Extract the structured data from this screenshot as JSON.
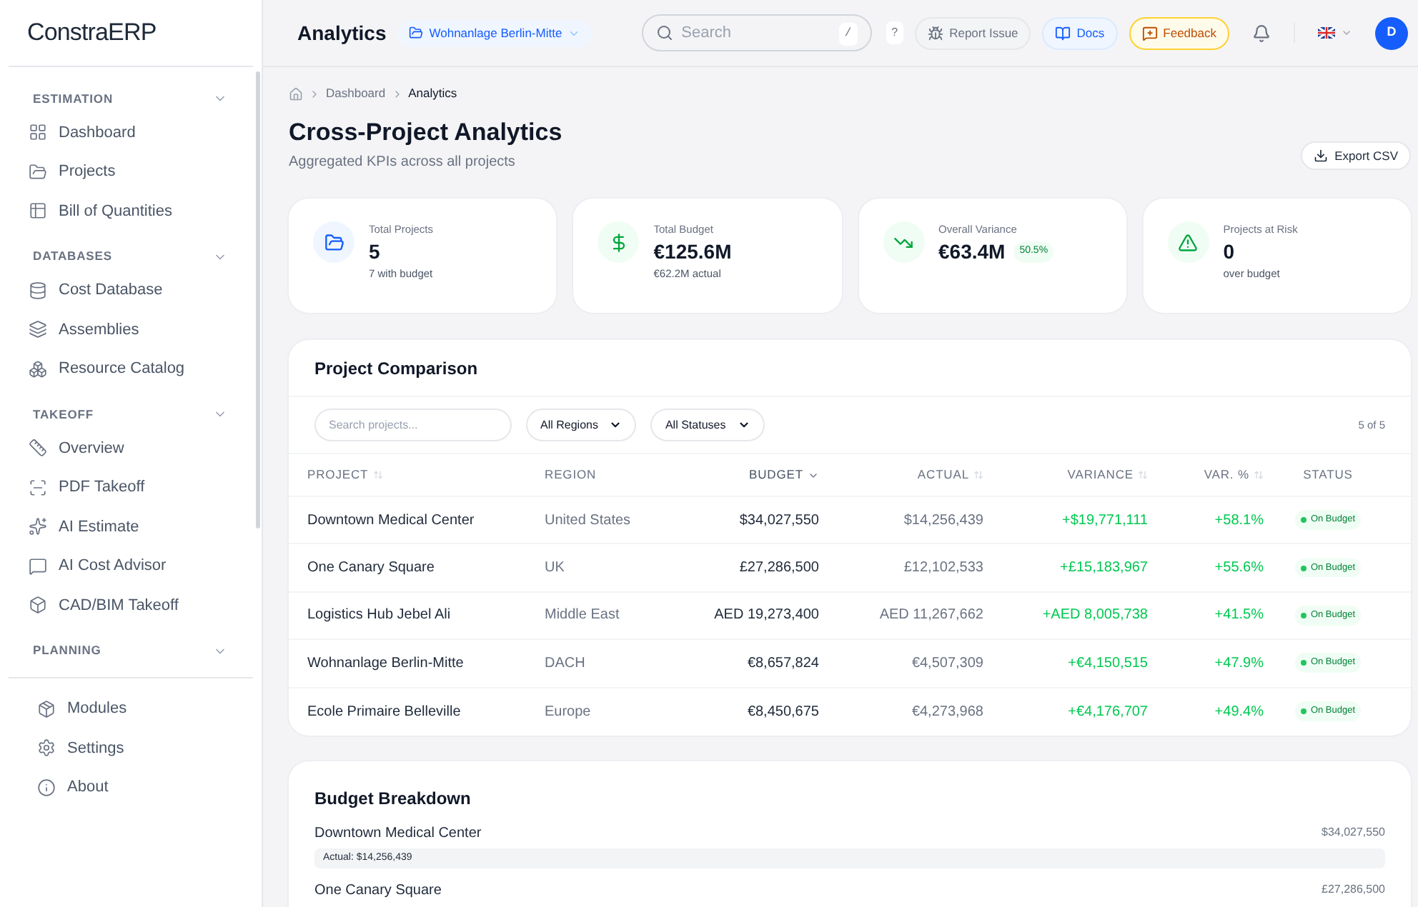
{
  "sidebar": {
    "logo": "ConstraERP",
    "sections": [
      {
        "label": "ESTIMATION",
        "expanded": true,
        "items": [
          "Dashboard",
          "Projects",
          "Bill of Quantities"
        ]
      },
      {
        "label": "DATABASES",
        "expanded": true,
        "items": [
          "Cost Database",
          "Assemblies",
          "Resource Catalog"
        ]
      },
      {
        "label": "TAKEOFF",
        "expanded": true,
        "items": [
          "Overview",
          "PDF Takeoff",
          "AI Estimate",
          "AI Cost Advisor",
          "CAD/BIM Takeoff"
        ]
      },
      {
        "label": "PLANNING",
        "expanded": true
      }
    ],
    "bottom_items": [
      "Modules",
      "Settings",
      "About"
    ]
  },
  "topbar": {
    "title": "Analytics",
    "project": "Wohnanlage Berlin-Mitte",
    "search": {
      "placeholder": "Search",
      "shortcut": "/"
    },
    "help": "?",
    "buttons": [
      {
        "label": "Report Issue",
        "kind": "report"
      },
      {
        "label": "Docs",
        "kind": "docs"
      },
      {
        "label": "Feedback",
        "kind": "feedback"
      }
    ],
    "avatar": "D"
  },
  "breadcrumb": [
    "Dashboard",
    "Analytics"
  ],
  "page": {
    "title": "Cross-Project Analytics",
    "subtitle": "Aggregated KPIs across all projects",
    "export": "Export CSV"
  },
  "kpis": [
    {
      "kind": "projects",
      "label": "Total Projects",
      "value": "5",
      "sub": "7 with budget"
    },
    {
      "kind": "budget",
      "label": "Total Budget",
      "value": "€125.6M",
      "sub": "€62.2M actual"
    },
    {
      "kind": "variance",
      "label": "Overall Variance",
      "value": "€63.4M",
      "badge": "50.5%"
    },
    {
      "kind": "risk",
      "label": "Projects at Risk",
      "value": "0",
      "sub": "over budget"
    }
  ],
  "comparison": {
    "title": "Project Comparison",
    "search": {
      "placeholder": "Search projects..."
    },
    "filters": [
      "All Regions",
      "All Statuses"
    ],
    "count": "5 of 5",
    "columns": [
      {
        "label": "PROJECT",
        "sorted": false
      },
      {
        "label": "REGION"
      },
      {
        "label": "BUDGET",
        "sorted": true
      },
      {
        "label": "ACTUAL",
        "sorted": false
      },
      {
        "label": "VARIANCE",
        "sorted": false
      },
      {
        "label": "VAR. %",
        "sorted": false
      },
      {
        "label": "STATUS"
      }
    ],
    "rows": [
      {
        "project": "Downtown Medical Center",
        "region": "United States",
        "budget": "$34,027,550",
        "actual": "$14,256,439",
        "variance": "+$19,771,111",
        "var_pct": "+58.1%",
        "status": {
          "label": "On Budget",
          "color": "#22c55e"
        }
      },
      {
        "project": "One Canary Square",
        "region": "UK",
        "budget": "£27,286,500",
        "actual": "£12,102,533",
        "variance": "+£15,183,967",
        "var_pct": "+55.6%",
        "status": {
          "label": "On Budget",
          "color": "#22c55e"
        }
      },
      {
        "project": "Logistics Hub Jebel Ali",
        "region": "Middle East",
        "budget": "AED 19,273,400",
        "actual": "AED 11,267,662",
        "variance": "+AED 8,005,738",
        "var_pct": "+41.5%",
        "status": {
          "label": "On Budget",
          "color": "#22c55e"
        }
      },
      {
        "project": "Wohnanlage Berlin-Mitte",
        "region": "DACH",
        "budget": "€8,657,824",
        "actual": "€4,507,309",
        "variance": "+€4,150,515",
        "var_pct": "+47.9%",
        "status": {
          "label": "On Budget",
          "color": "#22c55e"
        }
      },
      {
        "project": "Ecole Primaire Belleville",
        "region": "Europe",
        "budget": "€8,450,675",
        "actual": "€4,273,968",
        "variance": "+€4,176,707",
        "var_pct": "+49.4%",
        "status": {
          "label": "On Budget",
          "color": "#22c55e"
        }
      }
    ]
  },
  "breakdown": {
    "title": "Budget Breakdown",
    "items": [
      {
        "name": "Downtown Medical Center",
        "budget": "$34,027,550",
        "actual": "Actual: $14,256,439"
      },
      {
        "name": "One Canary Square",
        "budget": "£27,286,500"
      }
    ]
  }
}
